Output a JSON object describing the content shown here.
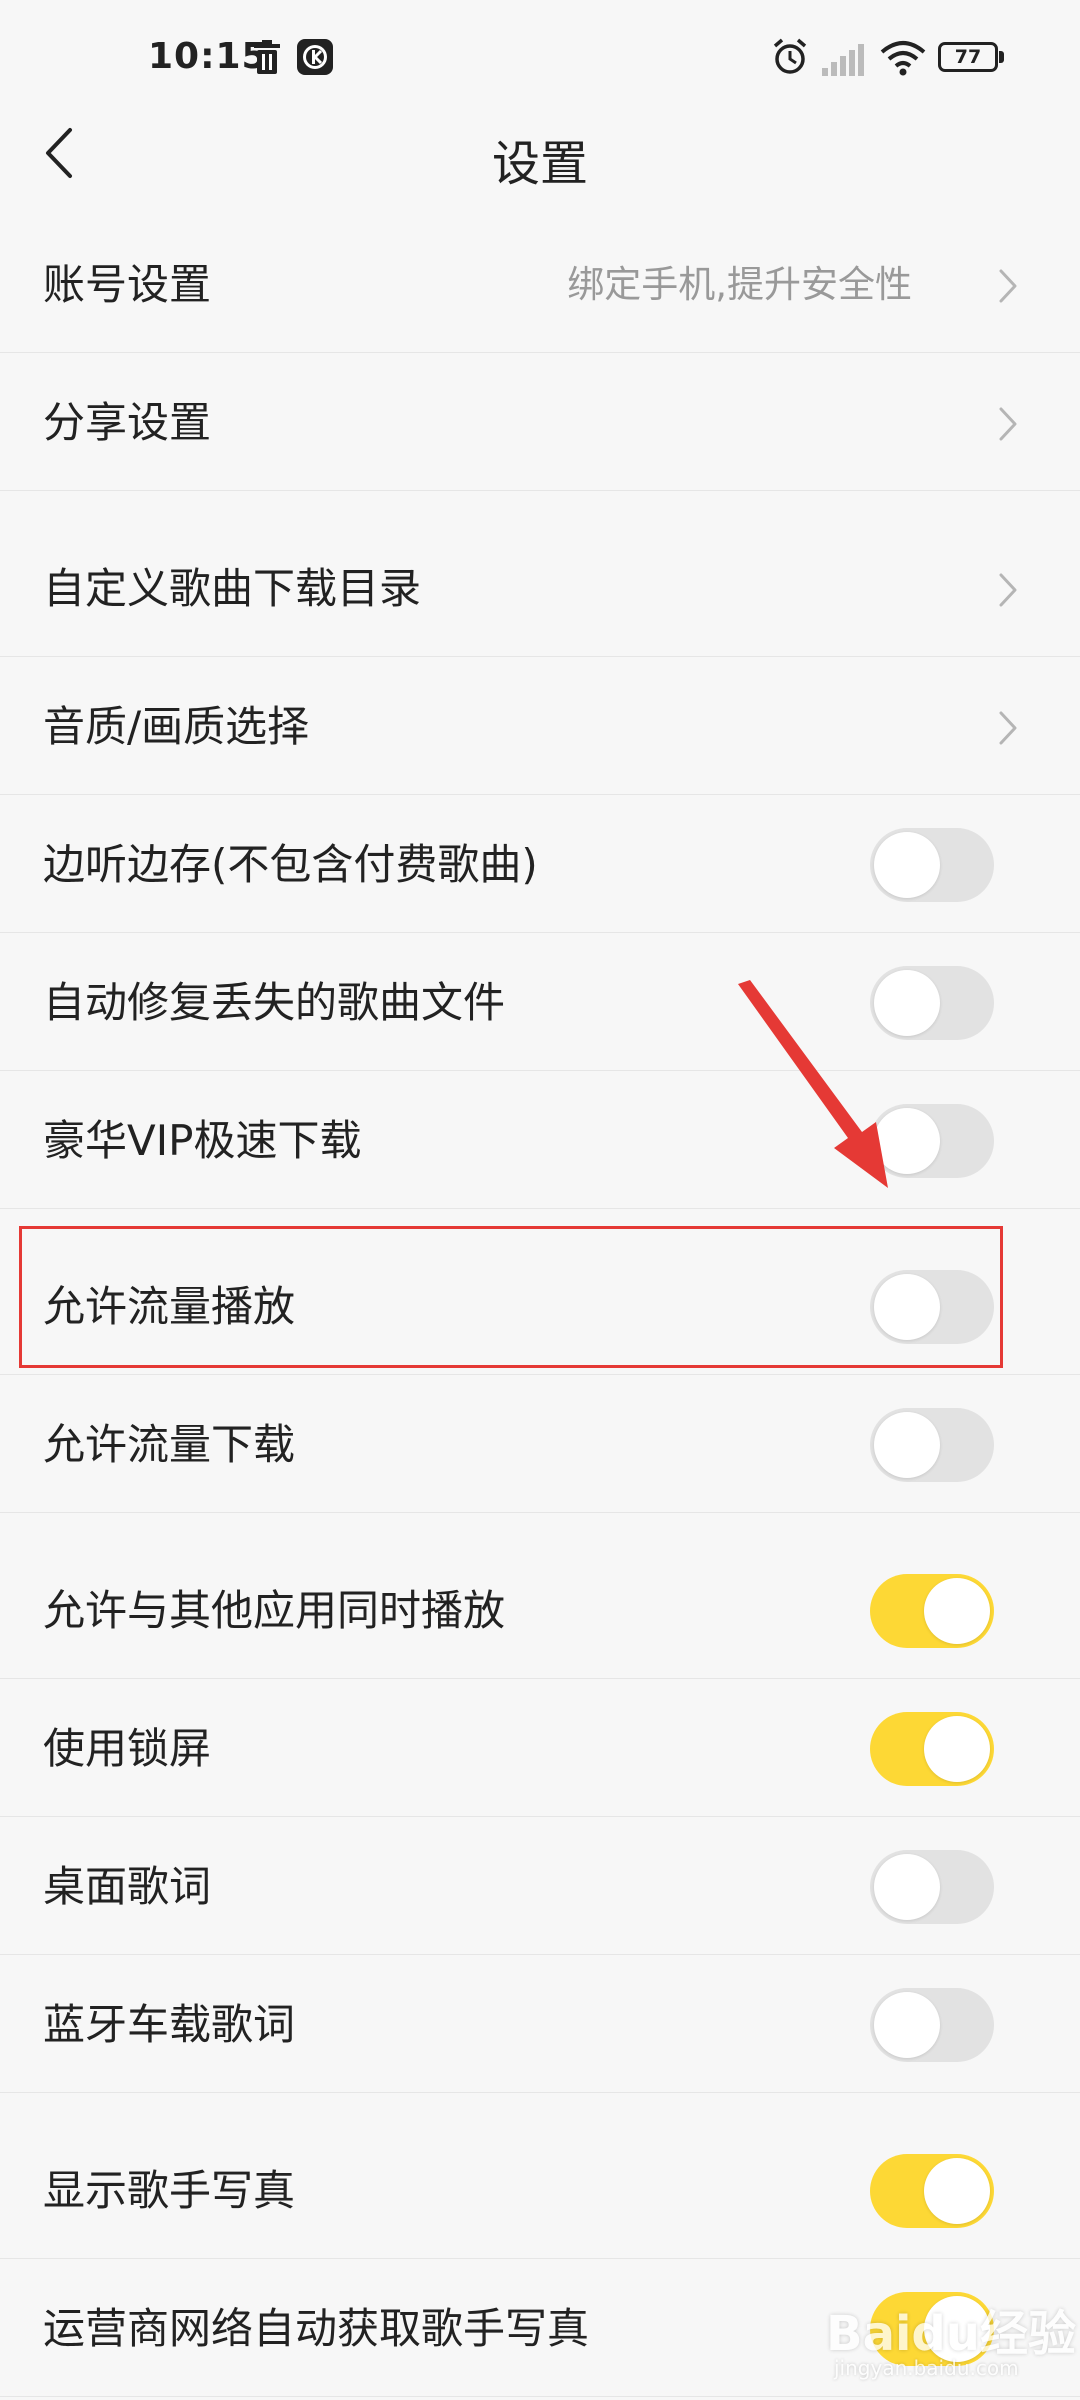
{
  "status_bar": {
    "time": "10:15",
    "battery": "77",
    "icons": [
      "trash-icon",
      "app-notification-icon",
      "alarm-icon",
      "signal-icon",
      "wifi-icon",
      "battery-icon"
    ]
  },
  "header": {
    "title": "设置",
    "back_icon": "chevron-left-icon"
  },
  "colors": {
    "toggle_on": "#fdd835",
    "toggle_off": "#e2e2e2",
    "annotation_red": "#e53935",
    "background": "#f7f7f7"
  },
  "settings": [
    {
      "label": "账号设置",
      "value": "绑定手机,提升安全性",
      "control": "chevron"
    },
    {
      "label": "分享设置",
      "control": "chevron"
    },
    {
      "label": "自定义歌曲下载目录",
      "control": "chevron"
    },
    {
      "label": "音质/画质选择",
      "control": "chevron"
    },
    {
      "label": "边听边存(不包含付费歌曲)",
      "control": "toggle",
      "on": false
    },
    {
      "label": "自动修复丢失的歌曲文件",
      "control": "toggle",
      "on": false
    },
    {
      "label": "豪华VIP极速下载",
      "control": "toggle",
      "on": false
    },
    {
      "label": "允许流量播放",
      "control": "toggle",
      "on": false
    },
    {
      "label": "允许流量下载",
      "control": "toggle",
      "on": false
    },
    {
      "label": "允许与其他应用同时播放",
      "control": "toggle",
      "on": true
    },
    {
      "label": "使用锁屏",
      "control": "toggle",
      "on": true
    },
    {
      "label": "桌面歌词",
      "control": "toggle",
      "on": false
    },
    {
      "label": "蓝牙车载歌词",
      "control": "toggle",
      "on": false
    },
    {
      "label": "显示歌手写真",
      "control": "toggle",
      "on": true
    },
    {
      "label": "运营商网络自动获取歌手写真",
      "control": "toggle",
      "on": true
    }
  ],
  "watermark": {
    "text": "Baidu经验",
    "sub": "jingyan.baidu.com"
  }
}
